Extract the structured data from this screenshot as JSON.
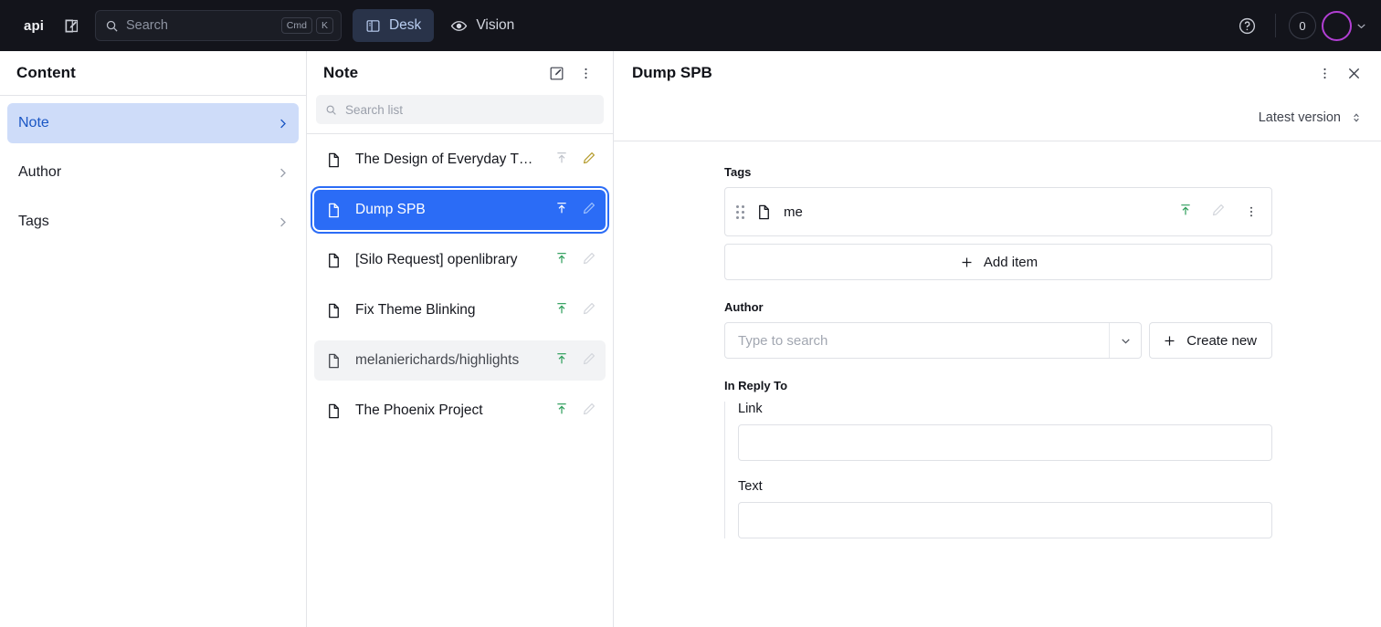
{
  "topbar": {
    "brand": "api",
    "compose_icon": "compose-icon",
    "search": {
      "placeholder": "Search",
      "icon": "search-icon",
      "kbd": [
        "Cmd",
        "K"
      ]
    },
    "nav": [
      {
        "label": "Desk",
        "icon": "desk-icon",
        "active": true
      },
      {
        "label": "Vision",
        "icon": "eye-icon",
        "active": false
      }
    ],
    "help_icon": "help-circle-icon",
    "count_badge": "0",
    "avatar": "user-avatar",
    "avatar_chevron": "chevron-down-icon"
  },
  "sidebar": {
    "title": "Content",
    "items": [
      {
        "label": "Note",
        "selected": true
      },
      {
        "label": "Author",
        "selected": false
      },
      {
        "label": "Tags",
        "selected": false
      }
    ]
  },
  "list_pane": {
    "title": "Note",
    "create_icon": "compose-icon",
    "menu_icon": "more-vertical-icon",
    "search": {
      "placeholder": "Search list",
      "icon": "search-icon"
    },
    "documents": [
      {
        "name": "The Design of Everyday T…",
        "published": false,
        "draft": true,
        "state": "normal"
      },
      {
        "name": "Dump SPB",
        "published": true,
        "draft": false,
        "state": "selected"
      },
      {
        "name": "[Silo Request] openlibrary",
        "published": true,
        "draft": false,
        "state": "normal"
      },
      {
        "name": "Fix Theme Blinking",
        "published": true,
        "draft": false,
        "state": "normal"
      },
      {
        "name": "melanierichards/highlights",
        "published": true,
        "draft": false,
        "state": "hovered"
      },
      {
        "name": "The Phoenix Project",
        "published": true,
        "draft": false,
        "state": "normal"
      }
    ]
  },
  "detail": {
    "title": "Dump SPB",
    "menu_icon": "more-vertical-icon",
    "close_icon": "close-icon",
    "version_label": "Latest version",
    "version_icon": "chevron-up-down-icon",
    "fields": {
      "tags": {
        "label": "Tags",
        "items": [
          {
            "label": "me",
            "published": true,
            "draft": false
          }
        ],
        "add_label": "Add item"
      },
      "author": {
        "label": "Author",
        "placeholder": "Type to search",
        "create_label": "Create new"
      },
      "in_reply_to": {
        "label": "In Reply To",
        "link": {
          "label": "Link",
          "value": ""
        },
        "text": {
          "label": "Text",
          "value": ""
        }
      }
    }
  },
  "colors": {
    "topbar_bg": "#13141b",
    "accent_blue": "#2b6cf6",
    "selected_nav_bg": "#cedcf9",
    "selected_nav_text": "#1a56c4",
    "published_green": "#2e9e5b",
    "draft_yellow": "#b59c2e",
    "avatar_ring": "#b23fd4"
  }
}
